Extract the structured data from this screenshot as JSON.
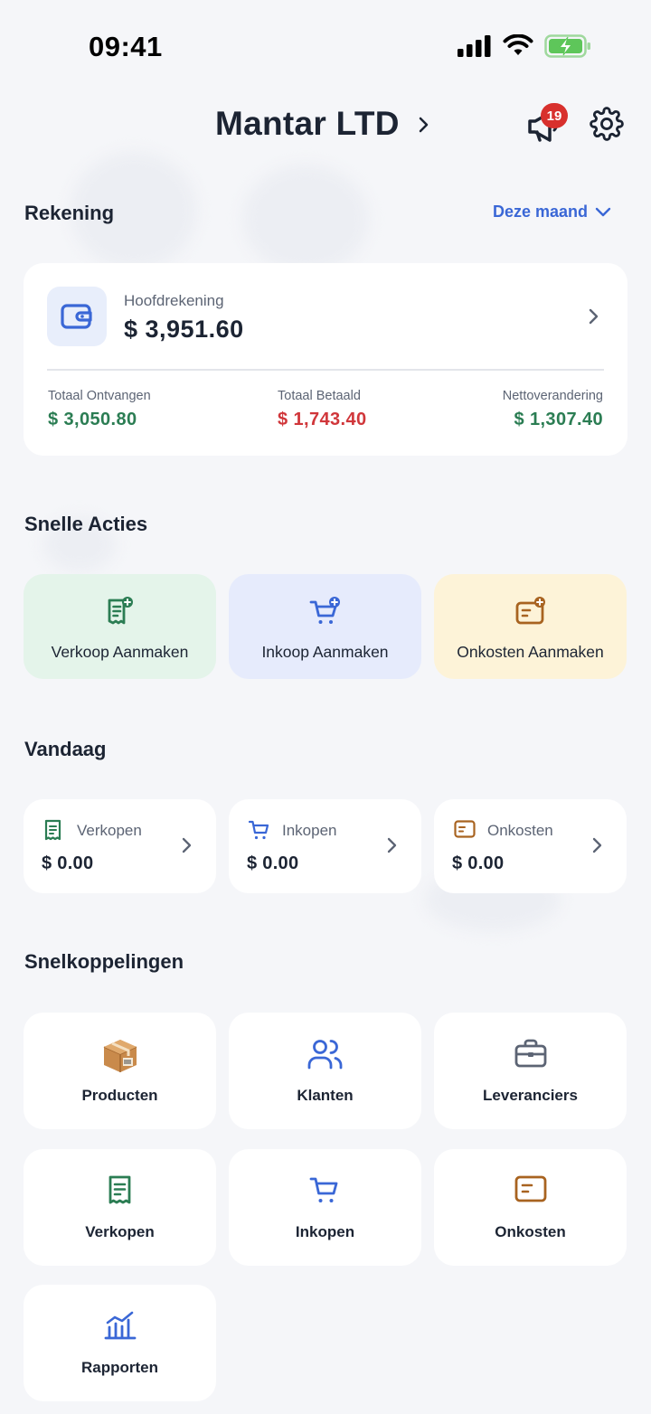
{
  "status_bar": {
    "time": "09:41"
  },
  "header": {
    "company": "Mantar LTD",
    "notification_count": "19"
  },
  "account": {
    "section_title": "Rekening",
    "period": "Deze maand",
    "label": "Hoofdrekening",
    "balance": "$ 3,951.60",
    "stats": [
      {
        "label": "Totaal Ontvangen",
        "value": "$ 3,050.80"
      },
      {
        "label": "Totaal Betaald",
        "value": "$ 1,743.40"
      },
      {
        "label": "Nettoverandering",
        "value": "$ 1,307.40"
      }
    ]
  },
  "quick_actions": {
    "title": "Snelle Acties",
    "items": [
      {
        "label": "Verkoop Aanmaken",
        "bg": "#e4f4ea",
        "icon": "receipt-plus-icon"
      },
      {
        "label": "Inkoop Aanmaken",
        "bg": "#e6ebfc",
        "icon": "cart-plus-icon"
      },
      {
        "label": "Onkosten Aanmaken",
        "bg": "#fdf3d8",
        "icon": "expense-plus-icon"
      }
    ]
  },
  "today": {
    "title": "Vandaag",
    "items": [
      {
        "label": "Verkopen",
        "value": "$ 0.00",
        "icon": "receipt-icon"
      },
      {
        "label": "Inkopen",
        "value": "$ 0.00",
        "icon": "cart-icon"
      },
      {
        "label": "Onkosten",
        "value": "$ 0.00",
        "icon": "expense-icon"
      }
    ]
  },
  "shortcuts": {
    "title": "Snelkoppelingen",
    "items": [
      {
        "label": "Producten",
        "icon": "package-icon"
      },
      {
        "label": "Klanten",
        "icon": "users-icon"
      },
      {
        "label": "Leveranciers",
        "icon": "briefcase-icon"
      },
      {
        "label": "Verkopen",
        "icon": "receipt-icon"
      },
      {
        "label": "Inkopen",
        "icon": "cart-icon"
      },
      {
        "label": "Onkosten",
        "icon": "expense-icon"
      },
      {
        "label": "Rapporten",
        "icon": "chart-icon"
      }
    ]
  },
  "colors": {
    "accent": "#3a67d6",
    "green": "#2b7d53",
    "red": "#d0363a",
    "brown": "#a86320"
  }
}
